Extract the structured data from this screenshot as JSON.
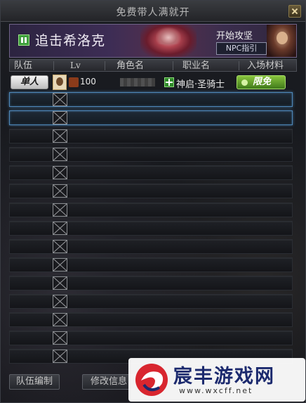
{
  "window": {
    "title": "免费带人满就开"
  },
  "banner": {
    "dungeon_name": "追击希洛克",
    "start_attack_label": "开始攻坚",
    "npc_guide_label": "NPC指引"
  },
  "table_header": {
    "team": "队伍",
    "lv": "Lv",
    "name": "角色名",
    "job": "职业名",
    "ticket": "入场材料"
  },
  "player": {
    "team_badge": "单人",
    "level": "100",
    "job_name": "神启·圣骑士",
    "ticket_badge": "限免"
  },
  "slots": {
    "count": 15,
    "selected_index": [
      0,
      1
    ]
  },
  "footer": {
    "team_edit_label": "队伍编制",
    "modify_info_label": "修改信息"
  },
  "watermark": {
    "title": "宸丰游戏网",
    "url": "www.wxcff.net"
  },
  "colors": {
    "accent_selected": "#4e87b8",
    "free_badge": "#6aa832",
    "job_icon": "#2f8a2a"
  }
}
